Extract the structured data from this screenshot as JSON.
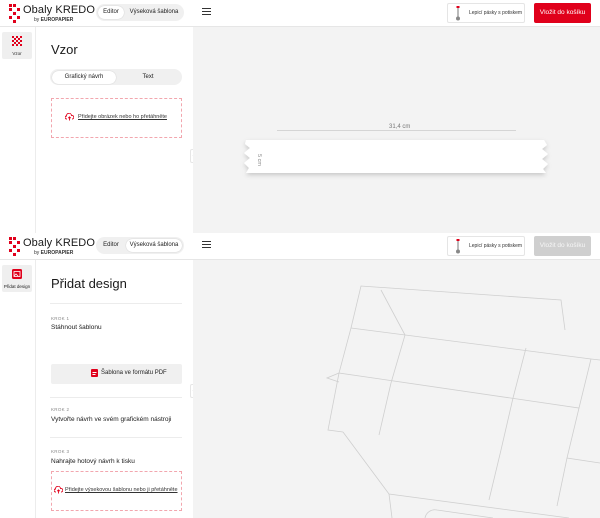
{
  "app": {
    "logo_title": "Obaly KREDO",
    "logo_by": "by",
    "logo_brand": "EUROPAPIER"
  },
  "colors": {
    "brand": "#e0001b",
    "disabled": "#cfcfcf",
    "canvas": "#f3f3f3"
  },
  "screen1": {
    "header": {
      "editor_tab": "Editor",
      "template_tab": "Výseková šablona",
      "tape_label": "Lepicí pásky s potiskem",
      "cart_label": "Vložit do košíku"
    },
    "rail": {
      "item_label": "Vzor",
      "icon": "pattern-icon"
    },
    "panel": {
      "title": "Vzor",
      "tabs": [
        "Grafický návrh",
        "Text"
      ],
      "upload_text": "Přidejte obrázek nebo ho přetáhněte"
    },
    "canvas": {
      "length_label": "31,4 cm",
      "width_label": "5 cm"
    }
  },
  "screen2": {
    "header": {
      "editor_tab": "Editor",
      "template_tab": "Výseková šablona",
      "tape_label": "Lepicí pásky s potiskem",
      "cart_label": "Vložit do košíku"
    },
    "rail": {
      "item_label": "Přidat design",
      "icon": "add-design-icon"
    },
    "panel": {
      "title": "Přidat design",
      "steps": [
        {
          "label": "KROK 1",
          "title": "Stáhnout šablonu"
        },
        {
          "label": "KROK 2",
          "title": "Vytvořte návrh ve svém grafickém nástroji"
        },
        {
          "label": "KROK 3",
          "title": "Nahrajte hotový návrh k tisku"
        }
      ],
      "pdf_button": "Šablona ve formátu PDF",
      "upload_text": "Přidejte výsekovou šablonu nebo ji přetáhněte"
    }
  }
}
